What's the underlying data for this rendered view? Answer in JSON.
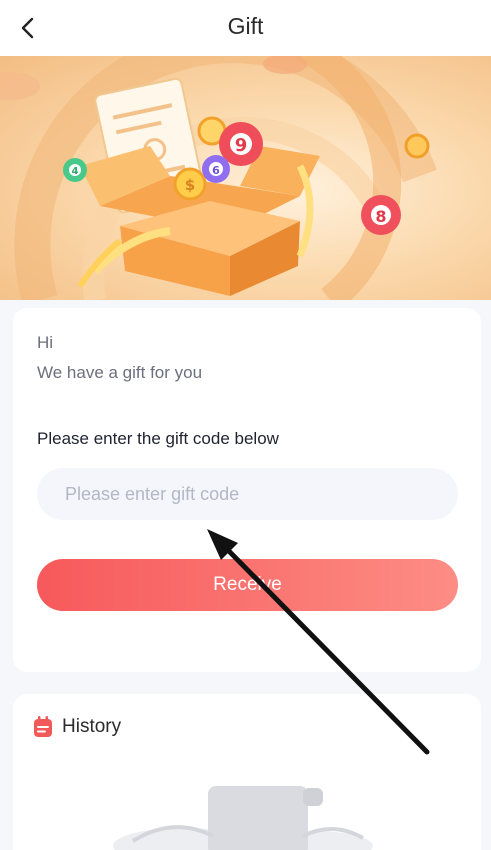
{
  "header": {
    "title": "Gift"
  },
  "gift": {
    "greeting": "Hi",
    "subtitle": "We have a gift for you",
    "prompt": "Please enter the gift code below",
    "input_value": "",
    "input_placeholder": "Please enter gift code",
    "button_label": "Receive"
  },
  "history": {
    "title": "History"
  },
  "banner": {
    "ball_numbers": [
      "4",
      "9",
      "6",
      "8",
      "$"
    ]
  },
  "colors": {
    "accent_start": "#f7595b",
    "accent_end": "#fd8d85",
    "history_icon": "#f25a5a",
    "banner_bg": "#f6c995"
  },
  "icons": {
    "back": "chevron-left-icon",
    "history": "calendar-note-icon",
    "arrow": "annotation-arrow-icon"
  }
}
